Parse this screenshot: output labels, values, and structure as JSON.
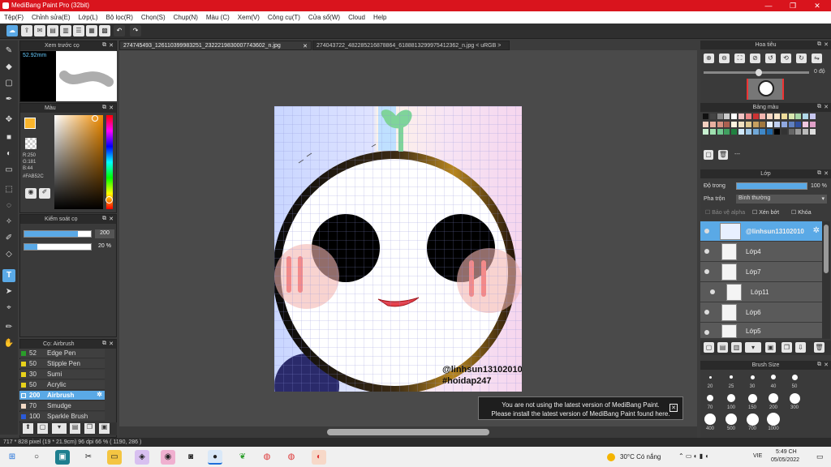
{
  "app": {
    "title": "MediBang Paint Pro (32bit)",
    "window_controls": [
      "—",
      "❐",
      "✕"
    ]
  },
  "menu": [
    "Tệp(F)",
    "Chỉnh sửa(E)",
    "Lớp(L)",
    "Bộ lọc(R)",
    "Chọn(S)",
    "Chụp(N)",
    "Màu (C)",
    "Xem(V)",
    "Công cụ(T)",
    "Cửa sổ(W)",
    "Cloud",
    "Help"
  ],
  "tabs": [
    {
      "label": "274745493_126110399983251_2322219830007743602_n.jpg",
      "close": "✕"
    },
    {
      "label": "274043722_482285216878864_6188813299975412362_n.jpg < uRGB >",
      "close": ""
    }
  ],
  "brush_preview": {
    "title": "Xem trước cọ",
    "size": "52.92mm"
  },
  "color_panel": {
    "title": "Màu",
    "r": "R:250",
    "g": "G:181",
    "b": "B:44",
    "hex": "#FAB52C",
    "primary": "#FAB52C"
  },
  "brush_control": {
    "title": "Kiểm soát cọ",
    "size": "200",
    "opacity": "20 %",
    "size_fill": 0.8,
    "opacity_fill": 0.2
  },
  "brush_list": {
    "title": "Cọ: Airbrush",
    "items": [
      {
        "value": "52",
        "name": "Edge Pen",
        "color": "#2a9d2a"
      },
      {
        "value": "50",
        "name": "Stipple Pen",
        "color": "#e8d21a"
      },
      {
        "value": "30",
        "name": "Sumi",
        "color": "#e8d21a"
      },
      {
        "value": "50",
        "name": "Acrylic",
        "color": "#e8d21a"
      },
      {
        "value": "200",
        "name": "Airbrush",
        "color": "#6bb0e0"
      },
      {
        "value": "70",
        "name": "Smudge",
        "color": "#f2d9c4"
      },
      {
        "value": "100",
        "name": "Sparkle Brush",
        "color": "#2a5ad8"
      }
    ]
  },
  "navigator": {
    "title": "Hoa tiêu",
    "angle": "0 độ"
  },
  "palette": {
    "title": "Bảng màu",
    "name": "---"
  },
  "layer_panel": {
    "title": "Lớp",
    "opacity_label": "Độ trong",
    "opacity_value": "100 %",
    "blend_label": "Pha trộn",
    "blend_value": "Bình thường",
    "alpha_protect": "Bảo vệ alpha",
    "clipping": "Xén bớt",
    "lock": "Khóa",
    "layers": [
      "@linhsun13102010",
      "Lớp4",
      "Lớp7",
      "Lớp11",
      "Lớp6",
      "Lớp5"
    ]
  },
  "brush_size": {
    "title": "Brush Size",
    "sizes": [
      "20",
      "25",
      "30",
      "40",
      "50",
      "70",
      "100",
      "150",
      "200",
      "300",
      "400",
      "500",
      "700",
      "1000"
    ]
  },
  "artwork": {
    "watermark1": "@linhsun13102010",
    "watermark2": "#hoidap247"
  },
  "notice": {
    "line1": "You are not using the latest version of MediBang Paint.",
    "line2": "Please install the latest version of MediBang Paint found here."
  },
  "status": {
    "text": "717 * 828 pixel   (19 * 21.9cm)   96 dpi   66 %   ( 1190, 286 )"
  },
  "taskbar": {
    "weather": "30°C  Có nắng",
    "lang": "VIE",
    "time": "5:49 CH",
    "date": "05/05/2022"
  }
}
